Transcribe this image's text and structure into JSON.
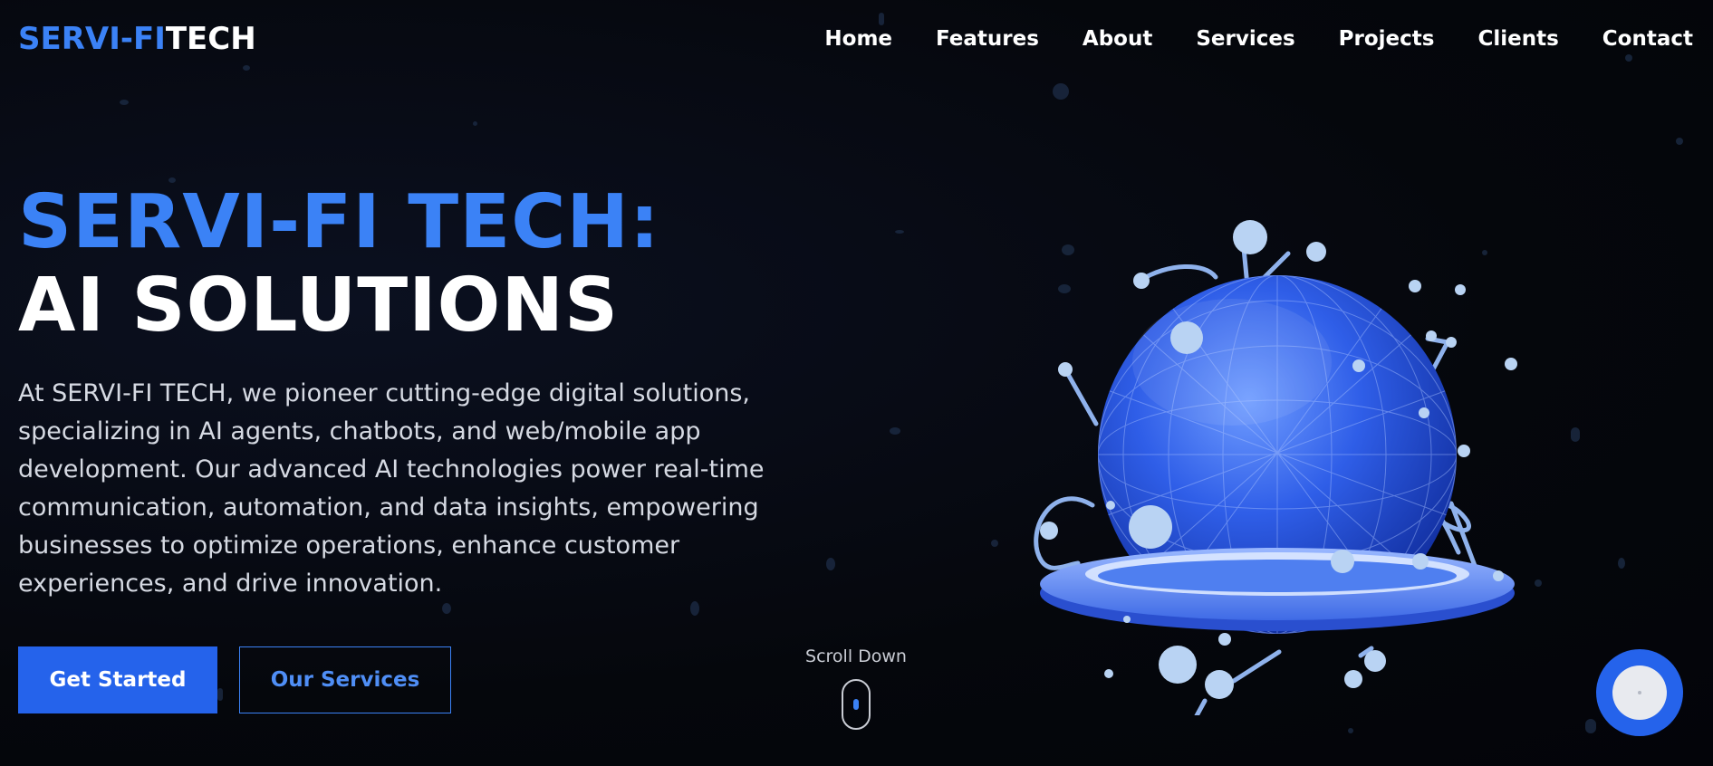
{
  "brand": {
    "logo_accent": "SERVI-FI",
    "logo_rest": "TECH",
    "accent_color": "#3b82f6"
  },
  "nav": {
    "items": [
      {
        "label": "Home"
      },
      {
        "label": "Features"
      },
      {
        "label": "About"
      },
      {
        "label": "Services"
      },
      {
        "label": "Projects"
      },
      {
        "label": "Clients"
      },
      {
        "label": "Contact"
      }
    ]
  },
  "hero": {
    "title_line1": "SERVI-FI TECH:",
    "title_line2": "AI SOLUTIONS",
    "description": "At SERVI-FI TECH, we pioneer cutting-edge digital solutions, specializing in AI agents, chatbots, and web/mobile app development. Our advanced AI technologies power real-time communication, automation, and data insights, empowering businesses to optimize operations, enhance customer experiences, and drive innovation.",
    "primary_button": "Get Started",
    "secondary_button": "Our Services",
    "scroll_label": "Scroll Down"
  },
  "icons": {
    "globe": "globe-network-icon",
    "mouse": "mouse-scroll-icon",
    "chat": "chat-icon"
  }
}
